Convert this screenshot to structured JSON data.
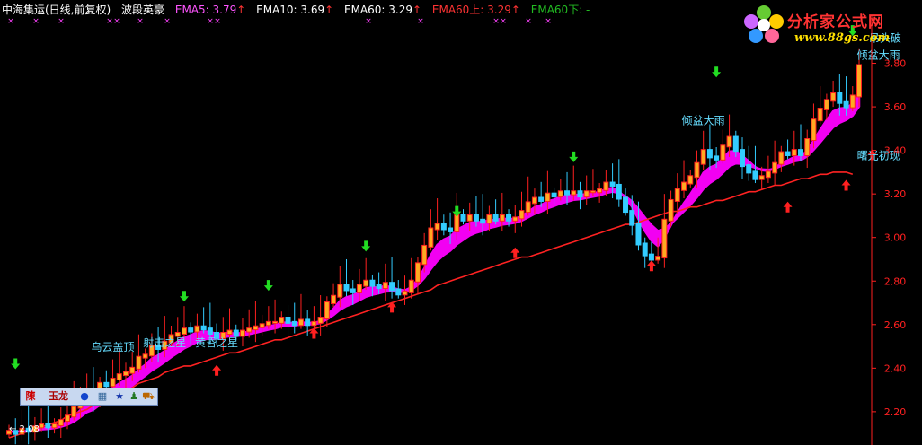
{
  "header": {
    "stock": "中海集运(日线,前复权)",
    "indicator_name": "波段英豪",
    "ema5": "EMA5: 3.79",
    "ema10": "EMA10: 3.69",
    "ema60": "EMA60: 3.29",
    "ema60_up": "EMA60上: 3.29",
    "ema60_down": "EMA60下: -"
  },
  "logo": {
    "site_name": "分析家公式网",
    "url": "www.88gs.com"
  },
  "toolbar": {
    "char1": "陳",
    "char2": "玉龙"
  },
  "colors": {
    "up_candle": "#ff2020",
    "down_candle": "#33ccff",
    "ema_ribbon": "#ff00ff",
    "ema60_line": "#ff2222",
    "buy_arrow": "#ff2020",
    "sell_arrow": "#22dd22",
    "annotation": "#66ddff",
    "axis": "#ff2020",
    "ema5_text": "#ff55ff",
    "ema10_text": "#ffffff",
    "ema60_up_text": "#ff3333",
    "ema60_down_text": "#22bb22"
  },
  "chart_data": {
    "type": "candlestick",
    "ylim": [
      2.08,
      4.0
    ],
    "yticks": [
      "2.20",
      "2.40",
      "2.60",
      "2.80",
      "3.00",
      "3.20",
      "3.40",
      "3.60",
      "3.80"
    ],
    "low_label": "2.08",
    "close": [
      2.11,
      2.1,
      2.12,
      2.11,
      2.13,
      2.14,
      2.13,
      2.14,
      2.16,
      2.18,
      2.22,
      2.27,
      2.3,
      2.26,
      2.33,
      2.32,
      2.35,
      2.37,
      2.38,
      2.4,
      2.45,
      2.46,
      2.5,
      2.49,
      2.52,
      2.55,
      2.56,
      2.58,
      2.57,
      2.59,
      2.58,
      2.56,
      2.54,
      2.56,
      2.57,
      2.55,
      2.57,
      2.58,
      2.59,
      2.6,
      2.61,
      2.61,
      2.63,
      2.61,
      2.6,
      2.62,
      2.6,
      2.61,
      2.63,
      2.7,
      2.73,
      2.78,
      2.76,
      2.75,
      2.78,
      2.8,
      2.78,
      2.77,
      2.79,
      2.76,
      2.74,
      2.75,
      2.8,
      2.88,
      2.96,
      3.04,
      3.06,
      3.04,
      3.03,
      3.1,
      3.08,
      3.1,
      3.08,
      3.07,
      3.1,
      3.08,
      3.1,
      3.08,
      3.09,
      3.12,
      3.16,
      3.18,
      3.17,
      3.2,
      3.19,
      3.21,
      3.2,
      3.21,
      3.19,
      3.21,
      3.21,
      3.22,
      3.25,
      3.24,
      3.18,
      3.12,
      3.06,
      2.97,
      2.92,
      2.9,
      2.91,
      3.08,
      3.17,
      3.22,
      3.25,
      3.28,
      3.34,
      3.4,
      3.37,
      3.36,
      3.42,
      3.46,
      3.4,
      3.33,
      3.3,
      3.27,
      3.28,
      3.3,
      3.34,
      3.39,
      3.38,
      3.4,
      3.38,
      3.45,
      3.54,
      3.59,
      3.63,
      3.66,
      3.62,
      3.6,
      3.65,
      3.79
    ],
    "ema60_line": [
      2.08,
      2.09,
      2.1,
      2.11,
      2.12,
      2.13,
      2.14,
      2.15,
      2.16,
      2.18,
      2.19,
      2.2,
      2.21,
      2.23,
      2.24,
      2.25,
      2.27,
      2.28,
      2.3,
      2.31,
      2.33,
      2.34,
      2.35,
      2.36,
      2.38,
      2.39,
      2.4,
      2.41,
      2.41,
      2.42,
      2.43,
      2.44,
      2.45,
      2.46,
      2.47,
      2.47,
      2.48,
      2.49,
      2.5,
      2.51,
      2.52,
      2.53,
      2.53,
      2.54,
      2.55,
      2.56,
      2.57,
      2.58,
      2.59,
      2.6,
      2.61,
      2.62,
      2.63,
      2.64,
      2.65,
      2.66,
      2.67,
      2.68,
      2.69,
      2.7,
      2.71,
      2.72,
      2.73,
      2.74,
      2.75,
      2.76,
      2.78,
      2.79,
      2.8,
      2.81,
      2.82,
      2.83,
      2.84,
      2.85,
      2.86,
      2.87,
      2.88,
      2.89,
      2.9,
      2.91,
      2.91,
      2.92,
      2.93,
      2.94,
      2.95,
      2.96,
      2.97,
      2.98,
      2.99,
      3.0,
      3.01,
      3.02,
      3.03,
      3.04,
      3.05,
      3.06,
      3.06,
      3.07,
      3.08,
      3.09,
      3.1,
      3.11,
      3.12,
      3.12,
      3.13,
      3.14,
      3.14,
      3.15,
      3.16,
      3.17,
      3.17,
      3.18,
      3.19,
      3.2,
      3.21,
      3.21,
      3.22,
      3.23,
      3.24,
      3.24,
      3.25,
      3.26,
      3.27,
      3.27,
      3.28,
      3.29,
      3.29,
      3.3,
      3.3,
      3.3,
      3.29
    ],
    "buy_signals": [
      {
        "i": 32,
        "y": 2.39
      },
      {
        "i": 47,
        "y": 2.56
      },
      {
        "i": 59,
        "y": 2.68
      },
      {
        "i": 78,
        "y": 2.93
      },
      {
        "i": 99,
        "y": 2.87
      },
      {
        "i": 120,
        "y": 3.14
      },
      {
        "i": 129,
        "y": 3.24
      },
      {
        "i": 133,
        "y": 3.38
      }
    ],
    "sell_signals": [
      {
        "i": 1,
        "y": 2.42
      },
      {
        "i": 27,
        "y": 2.73
      },
      {
        "i": 40,
        "y": 2.78
      },
      {
        "i": 55,
        "y": 2.96
      },
      {
        "i": 69,
        "y": 3.12
      },
      {
        "i": 87,
        "y": 3.37
      },
      {
        "i": 109,
        "y": 3.76
      },
      {
        "i": 130,
        "y": 3.95
      }
    ],
    "annotations": [
      {
        "label": "乌云盖顶",
        "i": 16,
        "y": 2.48
      },
      {
        "label": "射击之星",
        "i": 24,
        "y": 2.5
      },
      {
        "label": "黄昏之星",
        "i": 32,
        "y": 2.5
      },
      {
        "label": "倾盆大雨",
        "i": 107,
        "y": 3.52
      },
      {
        "label": "倾盆大雨",
        "i": 134,
        "y": 3.82
      },
      {
        "label": "吊头破",
        "i": 135,
        "y": 3.9
      },
      {
        "label": "曙光初现",
        "i": 134,
        "y": 3.36
      }
    ]
  }
}
